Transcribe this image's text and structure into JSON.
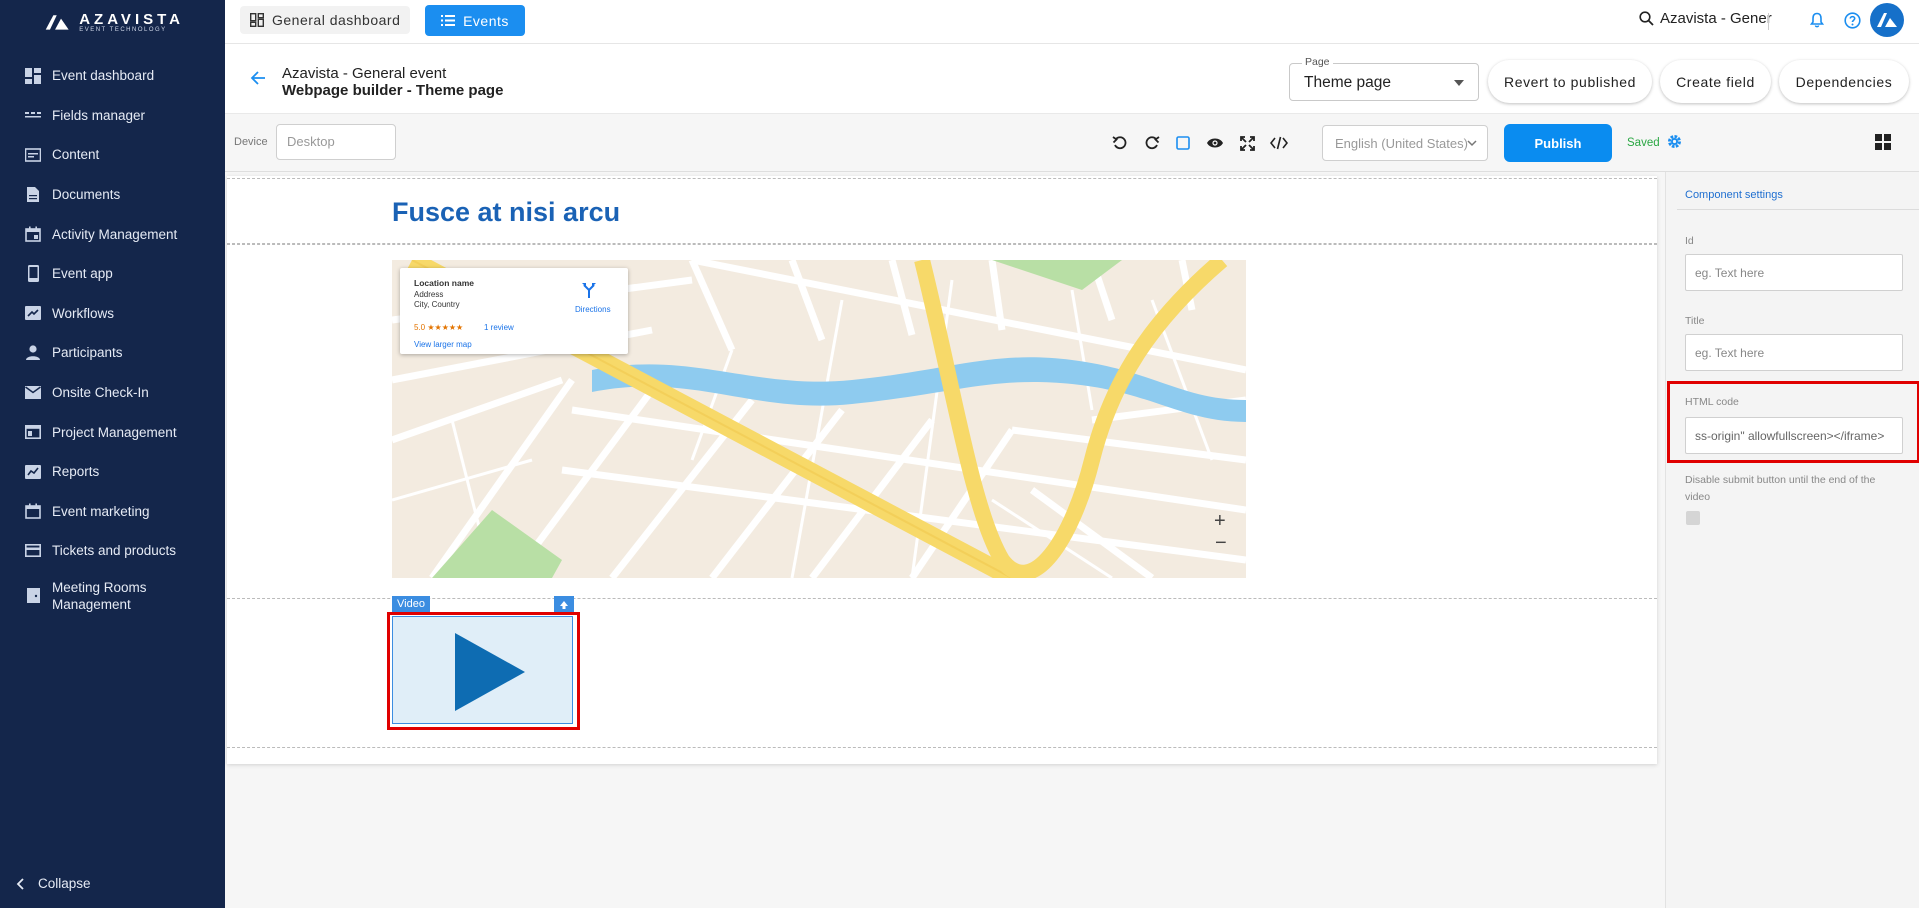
{
  "brand": {
    "name": "AZAVISTA",
    "tagline": "EVENT TECHNOLOGY"
  },
  "sidebar": {
    "items": [
      {
        "label": "Event dashboard",
        "icon": "dashboard-icon"
      },
      {
        "label": "Fields manager",
        "icon": "fields-icon"
      },
      {
        "label": "Content",
        "icon": "content-icon"
      },
      {
        "label": "Documents",
        "icon": "document-icon"
      },
      {
        "label": "Activity Management",
        "icon": "calendar-icon"
      },
      {
        "label": "Event app",
        "icon": "phone-icon"
      },
      {
        "label": "Workflows",
        "icon": "workflow-icon"
      },
      {
        "label": "Participants",
        "icon": "person-icon"
      },
      {
        "label": "Onsite Check-In",
        "icon": "mail-icon"
      },
      {
        "label": "Project Management",
        "icon": "project-icon"
      },
      {
        "label": "Reports",
        "icon": "reports-icon"
      },
      {
        "label": "Event marketing",
        "icon": "calendar-icon"
      },
      {
        "label": "Tickets and products",
        "icon": "card-icon"
      },
      {
        "label_line1": "Meeting Rooms",
        "label_line2": "Management",
        "icon": "room-icon"
      }
    ],
    "collapse_label": "Collapse"
  },
  "topbar": {
    "general_tab": "General dashboard",
    "events_tab": "Events",
    "search_text": "Azavista - Gener"
  },
  "header": {
    "event_name": "Azavista - General event",
    "page_title": "Webpage builder - Theme page",
    "page_select_label": "Page",
    "page_select_value": "Theme page",
    "buttons": {
      "revert": "Revert to published",
      "create_field": "Create field",
      "dependencies": "Dependencies"
    }
  },
  "toolbar": {
    "device_label": "Device",
    "device_value": "Desktop",
    "language_value": "English (United States)",
    "publish_label": "Publish",
    "status": "Saved"
  },
  "canvas": {
    "title": "Fusce at nisi arcu",
    "map_card": {
      "location_name": "Location name",
      "address": "Address",
      "city_country": "City, Country",
      "rating": "5.0 ★★★★★",
      "reviews": "1 review",
      "directions": "Directions",
      "larger_map": "View larger map"
    },
    "zoom_in": "+",
    "zoom_out": "−",
    "video_tag": "Video"
  },
  "component_settings": {
    "title": "Component settings",
    "id_label": "Id",
    "id_placeholder": "eg. Text here",
    "title_label": "Title",
    "title_placeholder": "eg. Text here",
    "html_label": "HTML code",
    "html_value": "ss-origin\" allowfullscreen></iframe>",
    "disable_submit_label": "Disable submit button until the end of the video"
  },
  "colors": {
    "sidebar_bg": "#14264b",
    "accent": "#1b8ef0",
    "title_blue": "#1a62b5",
    "highlight_red": "#e00000",
    "saved_green": "#2aa743"
  }
}
